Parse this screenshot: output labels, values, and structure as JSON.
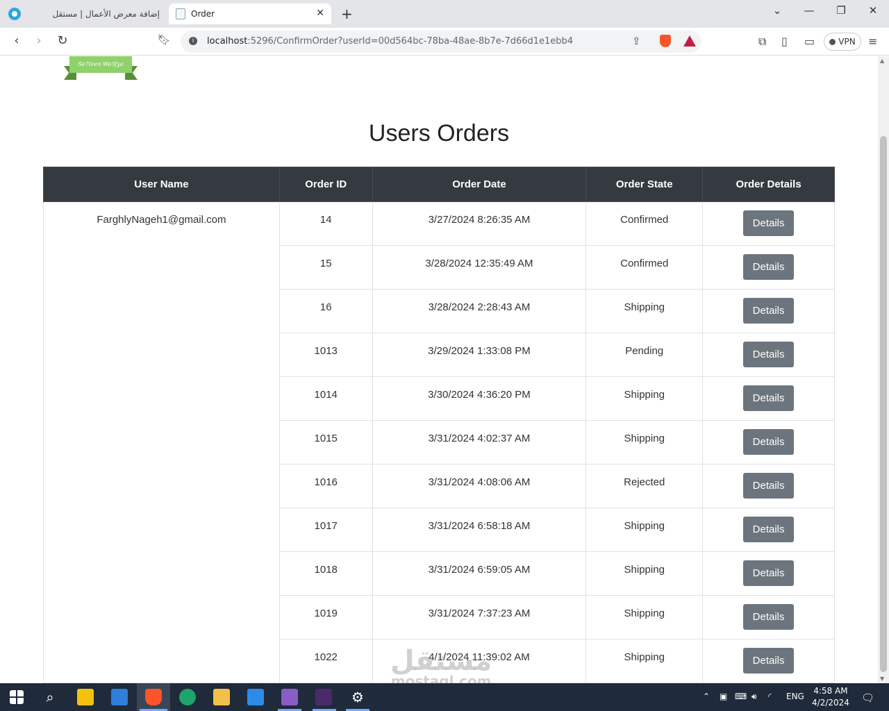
{
  "browser": {
    "tabs": [
      {
        "label": "إضافة معرض الأعمال | مستقل"
      },
      {
        "label": "Order"
      }
    ],
    "url_host": "localhost",
    "url_rest": ":5296/ConfirmOrder?userId=00d564bc-78ba-48ae-8b7e-7d66d1e1ebb4",
    "vpn_label": "VPN"
  },
  "logo": {
    "text": "Se7teen We3fya"
  },
  "page": {
    "title": "Users Orders",
    "columns": [
      "User Name",
      "Order ID",
      "Order Date",
      "Order State",
      "Order Details"
    ],
    "user_name": "FarghlyNageh1@gmail.com",
    "details_label": "Details",
    "orders": [
      {
        "id": "14",
        "date": "3/27/2024 8:26:35 AM",
        "state": "Confirmed"
      },
      {
        "id": "15",
        "date": "3/28/2024 12:35:49 AM",
        "state": "Confirmed"
      },
      {
        "id": "16",
        "date": "3/28/2024 2:28:43 AM",
        "state": "Shipping"
      },
      {
        "id": "1013",
        "date": "3/29/2024 1:33:08 PM",
        "state": "Pending"
      },
      {
        "id": "1014",
        "date": "3/30/2024 4:36:20 PM",
        "state": "Shipping"
      },
      {
        "id": "1015",
        "date": "3/31/2024 4:02:37 AM",
        "state": "Shipping"
      },
      {
        "id": "1016",
        "date": "3/31/2024 4:08:06 AM",
        "state": "Rejected"
      },
      {
        "id": "1017",
        "date": "3/31/2024 6:58:18 AM",
        "state": "Shipping"
      },
      {
        "id": "1018",
        "date": "3/31/2024 6:59:05 AM",
        "state": "Shipping"
      },
      {
        "id": "1019",
        "date": "3/31/2024 7:37:23 AM",
        "state": "Shipping"
      },
      {
        "id": "1022",
        "date": "4/1/2024 11:39:02 AM",
        "state": "Shipping"
      }
    ]
  },
  "watermark": {
    "arabic": "مستقل",
    "latin": "mostaql.com"
  },
  "taskbar": {
    "language": "ENG",
    "time": "4:58 AM",
    "date": "4/2/2024"
  }
}
